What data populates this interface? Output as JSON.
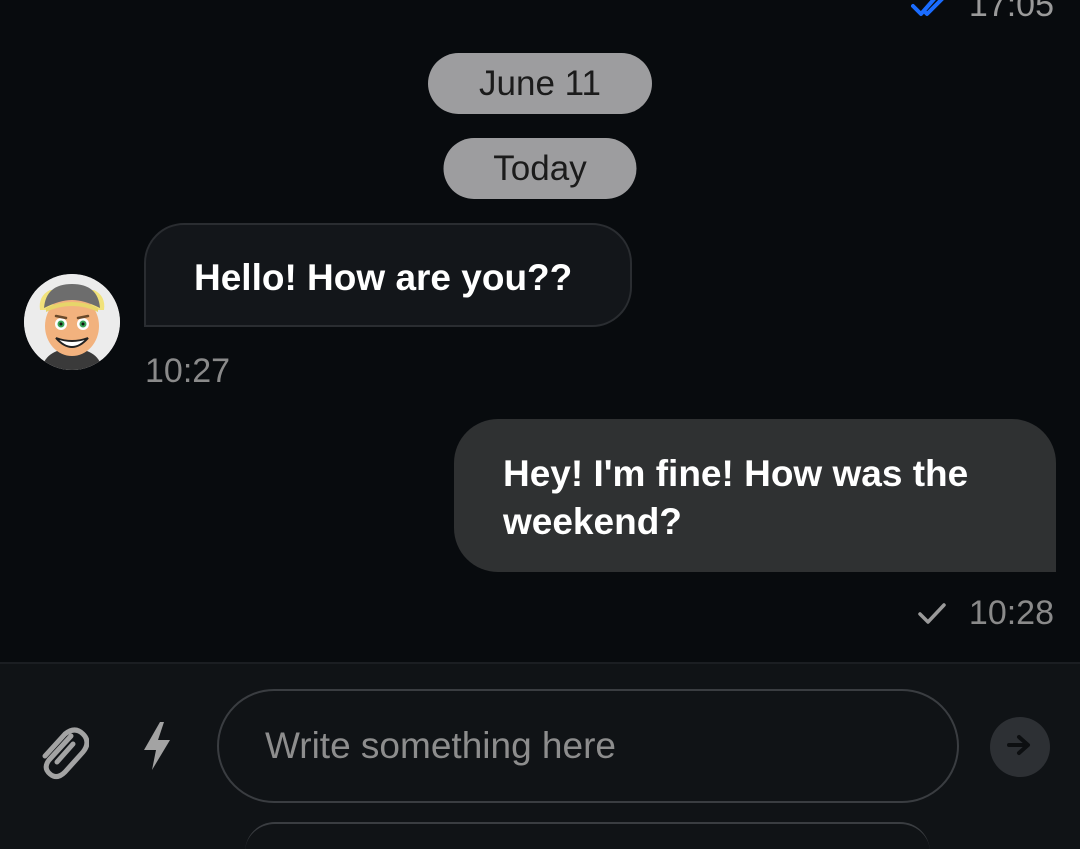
{
  "previous_message": {
    "time": "17:05",
    "status_icon": "double-check-icon",
    "status_color": "#1a6cff"
  },
  "date_separators": {
    "first": "June 11",
    "second": "Today"
  },
  "messages": [
    {
      "direction": "incoming",
      "text": "Hello! How are you??",
      "time": "10:27",
      "avatar_icon": "user-avatar"
    },
    {
      "direction": "outgoing",
      "text": "Hey! I'm fine! How was the weekend?",
      "time": "10:28",
      "status_icon": "check-icon"
    }
  ],
  "composer": {
    "placeholder": "Write something here",
    "value": "",
    "attach_icon": "paperclip-icon",
    "quick_icon": "lightning-icon",
    "send_icon": "arrow-right-icon"
  },
  "colors": {
    "background": "#080b0e",
    "incoming_bubble": "#13161a",
    "outgoing_bubble": "#2f3132",
    "date_pill": "#9d9d9f",
    "read_check": "#1a6cff"
  }
}
